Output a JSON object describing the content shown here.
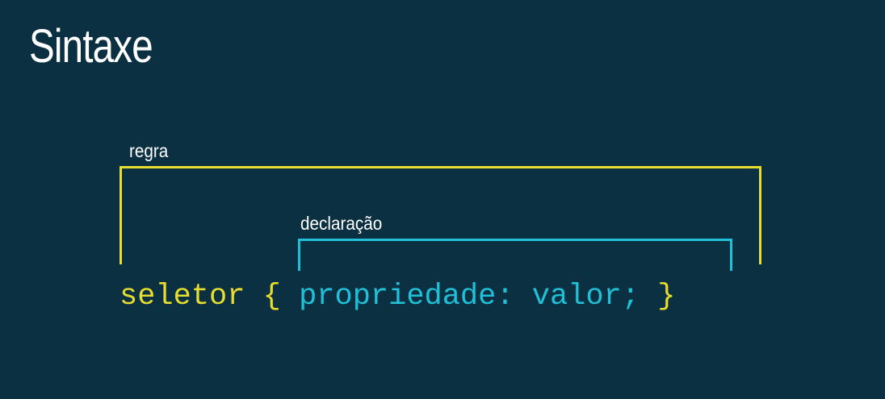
{
  "slide": {
    "title": "Sintaxe"
  },
  "labels": {
    "regra": "regra",
    "declaracao": "declaração"
  },
  "code": {
    "selector": "seletor",
    "open_brace": "{",
    "property": "propriedade:",
    "value": "valor;",
    "close_brace": "}"
  },
  "colors": {
    "background": "#0b3041",
    "rule": "#e8dc2e",
    "declaration": "#1fc0d8",
    "text": "#ffffff"
  }
}
